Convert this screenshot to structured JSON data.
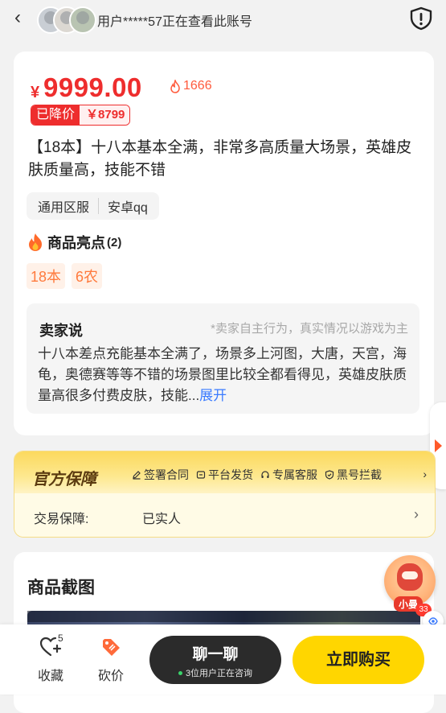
{
  "header": {
    "viewing_text": "用户*****57正在查看此账号"
  },
  "listing": {
    "currency": "¥",
    "price": "9999.00",
    "heat": "1666",
    "price_drop_label": "已降价",
    "price_drop_value": "￥8799",
    "title": "【18本】十八本基本全满，非常多高质量大场景，英雄皮肤质量高，技能不错",
    "chips": [
      "通用区服",
      "安卓qq"
    ]
  },
  "highlights": {
    "title": "商品亮点",
    "count": "(2)",
    "tags": [
      "18本",
      "6农"
    ]
  },
  "seller_note": {
    "heading": "卖家说",
    "disclaimer": "*卖家自主行为，真实情况以游戏为主",
    "body": "十八本差点充能基本全满了，场景多上河图，大唐，天宫，海龟，奥德赛等等不错的场景图里比较全都看得见，英雄皮肤质量高很多付费皮肤，技能...",
    "expand": "展开"
  },
  "guarantee": {
    "title": "官方保障",
    "items": [
      "签署合同",
      "平台发货",
      "专属客服",
      "黑号拦截"
    ],
    "row_label": "交易保障:",
    "row_value": "已实人"
  },
  "screenshots": {
    "title": "商品截图"
  },
  "assistant": {
    "label": "小曼",
    "badge": "33"
  },
  "bottom_bar": {
    "favorite_label": "收藏",
    "favorite_count": "5",
    "bargain_label": "砍价",
    "chat_label": "聊一聊",
    "chat_sub": "3位用户正在咨询",
    "buy_label": "立即购买"
  },
  "colors": {
    "price_red": "#ee2d2d",
    "accent_orange": "#ff7a3d",
    "buy_yellow": "#ffd600",
    "chat_dark": "#2b2b2b",
    "link_blue": "#3a7bff"
  }
}
